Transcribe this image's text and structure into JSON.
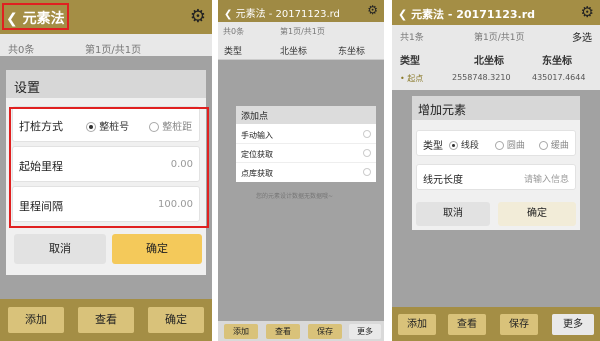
{
  "screen1": {
    "title": "元素法",
    "subbar": {
      "count": "共0条",
      "page": "第1页/共1页"
    },
    "dialog": {
      "title": "设置",
      "stake_label": "打桩方式",
      "stake_options": [
        "整桩号",
        "整桩距"
      ],
      "stake_selected": 0,
      "start_label": "起始里程",
      "start_value": "0.00",
      "interval_label": "里程间隔",
      "interval_value": "100.00",
      "cancel": "取消",
      "confirm": "确定"
    },
    "bottom": [
      "添加",
      "查看",
      "确定"
    ]
  },
  "screen2": {
    "title": "元素法 - 20171123.rd",
    "subbar": {
      "count": "共0条",
      "page": "第1页/共1页"
    },
    "columns": [
      "类型",
      "北坐标",
      "东坐标"
    ],
    "hint": "您的元素设计数据无数据哦~",
    "menu": {
      "title": "添加点",
      "items": [
        "手动输入",
        "定位获取",
        "点库获取"
      ]
    },
    "bottom": [
      "添加",
      "查看",
      "保存",
      "更多"
    ]
  },
  "screen3": {
    "title": "元素法 - 20171123.rd",
    "subbar": {
      "count": "共1条",
      "page": "第1页/共1页",
      "multi": "多选"
    },
    "columns": [
      "类型",
      "北坐标",
      "东坐标"
    ],
    "row": {
      "type": "起点",
      "north": "2558748.3210",
      "east": "435017.4644"
    },
    "dialog": {
      "title": "增加元素",
      "type_label": "类型",
      "type_options": [
        "线段",
        "圆曲",
        "缓曲"
      ],
      "type_selected": 0,
      "length_label": "线元长度",
      "length_placeholder": "请输入信息",
      "cancel": "取消",
      "confirm": "确定"
    },
    "bottom": [
      "添加",
      "查看",
      "保存",
      "更多"
    ]
  }
}
